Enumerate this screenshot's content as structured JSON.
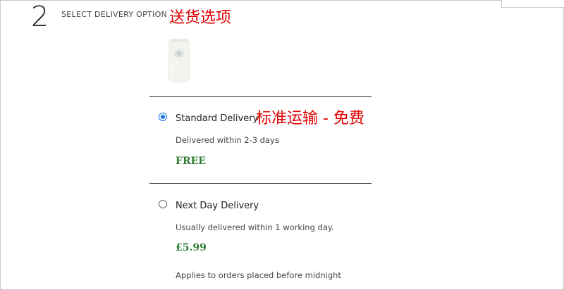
{
  "step": {
    "number": "2",
    "title": "SELECT DELIVERY OPTION"
  },
  "annotations": {
    "header_note": "送货选项",
    "standard_note": "标准运输 - 免费"
  },
  "product": {
    "icon": "product-tube-image"
  },
  "delivery_options": [
    {
      "label": "Standard Delivery",
      "description": "Delivered within 2-3 days",
      "price": "FREE",
      "selected": true
    },
    {
      "label": "Next Day Delivery",
      "description": "Usually delivered within 1 working day.",
      "price": "£5.99",
      "note": "Applies to orders placed before midnight",
      "selected": false
    }
  ],
  "colors": {
    "price_green": "#2e7d32",
    "annotation_red": "#e00000",
    "radio_blue": "#1a73e8"
  }
}
